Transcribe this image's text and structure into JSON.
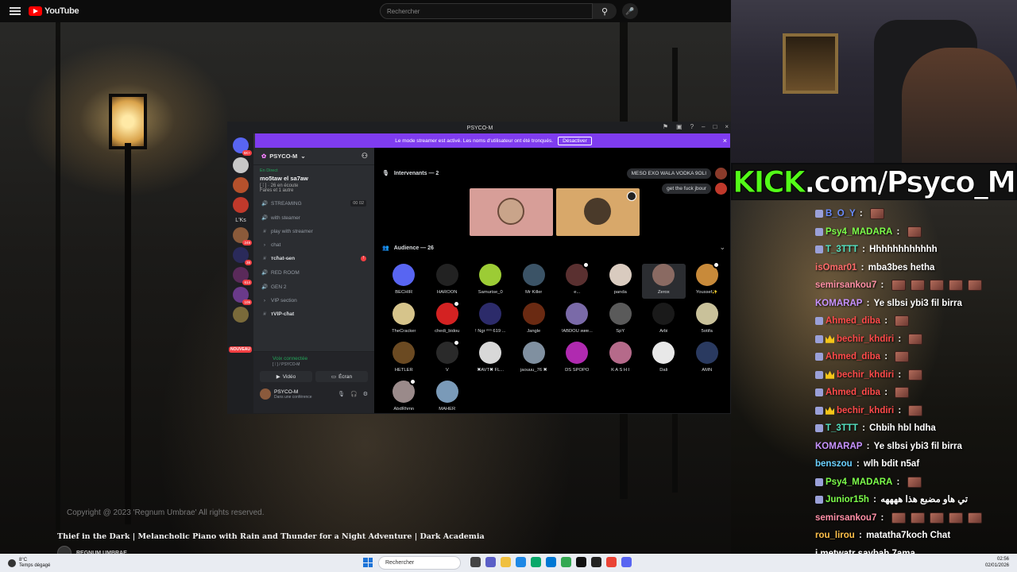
{
  "youtube": {
    "logo_text": "YouTube",
    "search_placeholder": "Rechercher",
    "copyright": "Copyright @ 2023 'Regnum Umbrae' All rights reserved.",
    "video_title": "Thief in the Dark | Melancholic Piano with Rain and Thunder for a Night Adventure | Dark Academia",
    "channel_name": "REGNUM UMBRAE"
  },
  "discord": {
    "window_title": "PSYCO-M",
    "banner_text": "Le mode streamer est activé. Les noms d'utilisateur ont été tronqués.",
    "banner_button": "Désactiver",
    "server_name": "PSYCO-M",
    "server_list": {
      "badge_1": "5K+",
      "text_item": "L'Ks",
      "badge_2": "249",
      "badge_3": "38",
      "badge_4": "614",
      "badge_5": "109",
      "new_label": "NOUVEAU"
    },
    "live": {
      "status": "En Direct",
      "title": "mo5taw el sa7aw",
      "sub": "[ ⁞ ]  ·  26 en écoute",
      "hosts": "Fares et 1 autre"
    },
    "channels": [
      {
        "label": "STREAMING",
        "count": "00 02"
      },
      {
        "label": "with steamer"
      },
      {
        "label": "play with streamer"
      },
      {
        "label": "chat"
      },
      {
        "label": "ᴛcħat-ɢen"
      },
      {
        "label": "RED ROOM"
      },
      {
        "label": "GEN 2"
      },
      {
        "label": "VIP section"
      },
      {
        "label": "ᴛVIP-cħat"
      }
    ],
    "voice": {
      "connected": "Voix connectée",
      "channel": "[ ⁞ ] / PSYCO-M",
      "video_btn": "Vidéo",
      "screen_btn": "Écran"
    },
    "user": {
      "name": "PSYCO-M",
      "status": "Dans une conférence"
    },
    "stage": {
      "speakers_header": "Intervenants — 2",
      "audience_header": "Audience — 26",
      "chat_chips": [
        "MESO EXO WALA VODKA 9OLI",
        "get the fuck jbour"
      ],
      "audience": [
        {
          "name": "BECHIR",
          "color": "#5865f2"
        },
        {
          "name": "HAROON",
          "color": "#222222"
        },
        {
          "name": "Samurise_0",
          "color": "#9ccc35"
        },
        {
          "name": "Mr Killer",
          "color": "#3b5366"
        },
        {
          "name": "e...",
          "color": "#5a3030"
        },
        {
          "name": "panda",
          "color": "#d9cbbf"
        },
        {
          "name": "Zerox",
          "color": "#8a6a62"
        },
        {
          "name": "Youssef✨",
          "color": "#c88a3a"
        },
        {
          "name": "TheCracker",
          "color": "#d6c48b"
        },
        {
          "name": "chedi_bidou",
          "color": "#d42222"
        },
        {
          "name": "! Ngr ᵐᵐ 619 ...",
          "color": "#2c2b6a"
        },
        {
          "name": "Jangle",
          "color": "#6a2a12"
        },
        {
          "name": "!ABDOU ʍʀɐ...",
          "color": "#7a6aa8"
        },
        {
          "name": "SpY",
          "color": "#5a5a5a"
        },
        {
          "name": "Arbi",
          "color": "#1a1a1a"
        },
        {
          "name": "5otifa",
          "color": "#c9c19a"
        },
        {
          "name": "HETLER",
          "color": "#6b4a22"
        },
        {
          "name": "V",
          "color": "#2a2a2a"
        },
        {
          "name": "✖AVT✖ FL...",
          "color": "#d8d8d8"
        },
        {
          "name": "jaouuu_76 ✖",
          "color": "#8090a0"
        },
        {
          "name": "DS SPOPO",
          "color": "#b02ab0"
        },
        {
          "name": "K A S H I",
          "color": "#b56a8a"
        },
        {
          "name": "Dali",
          "color": "#e8e8e8"
        },
        {
          "name": "AMN",
          "color": "#2a3a60"
        },
        {
          "name": "AbdRhmn",
          "color": "#9a8a8a"
        },
        {
          "name": "MAHER",
          "color": "#7a9ab8"
        }
      ]
    }
  },
  "stream": {
    "kick_brand": "KICK",
    "kick_rest": ".com/Psyco_M",
    "chat": [
      {
        "user": "B_O_Y",
        "color": "#6a8cff",
        "text": "",
        "badges": [
          "badge"
        ],
        "emotes": 1
      },
      {
        "user": "Psy4_MADARA",
        "color": "#7cfc4a",
        "text": "",
        "badges": [
          "badge"
        ],
        "emotes": 1
      },
      {
        "user": "T_3TTT",
        "color": "#53e0c0",
        "text": "Hhhhhhhhhhhh",
        "badges": [
          "badge"
        ],
        "emotes": 0
      },
      {
        "user": "isOmar01",
        "color": "#ff6a6a",
        "text": "mba3bes hetha",
        "badges": [],
        "emotes": 0
      },
      {
        "user": "semirsankou7",
        "color": "#ff8fa6",
        "text": "",
        "badges": [],
        "emotes": 5
      },
      {
        "user": "KOMARAP",
        "color": "#c792ff",
        "text": "Ye slbsi ybi3 fil birra",
        "badges": [],
        "emotes": 0
      },
      {
        "user": "Ahmed_diba",
        "color": "#ff4a4a",
        "text": "",
        "badges": [
          "badge"
        ],
        "emotes": 1
      },
      {
        "user": "bechir_khdiri",
        "color": "#ff4a4a",
        "text": "",
        "badges": [
          "badge",
          "crown"
        ],
        "emotes": 1
      },
      {
        "user": "Ahmed_diba",
        "color": "#ff4a4a",
        "text": "",
        "badges": [
          "badge"
        ],
        "emotes": 1
      },
      {
        "user": "bechir_khdiri",
        "color": "#ff4a4a",
        "text": "",
        "badges": [
          "badge",
          "crown"
        ],
        "emotes": 1
      },
      {
        "user": "Ahmed_diba",
        "color": "#ff4a4a",
        "text": "",
        "badges": [
          "badge"
        ],
        "emotes": 1
      },
      {
        "user": "bechir_khdiri",
        "color": "#ff4a4a",
        "text": "",
        "badges": [
          "badge",
          "crown"
        ],
        "emotes": 1
      },
      {
        "user": "T_3TTT",
        "color": "#53e0c0",
        "text": "Chbih hbl hdha",
        "badges": [
          "badge"
        ],
        "emotes": 0
      },
      {
        "user": "KOMARAP",
        "color": "#c792ff",
        "text": "Ye slbsi ybi3 fil birra",
        "badges": [],
        "emotes": 0
      },
      {
        "user": "benszou",
        "color": "#6ad0ff",
        "text": "wlh bdit n5af",
        "badges": [],
        "emotes": 0
      },
      {
        "user": "Psy4_MADARA",
        "color": "#7cfc4a",
        "text": "",
        "badges": [
          "badge"
        ],
        "emotes": 1
      },
      {
        "user": "Junior15h",
        "color": "#7cfc4a",
        "text": "تي هاو مضبع هذا ههههه",
        "badges": [
          "badge"
        ],
        "emotes": 0
      },
      {
        "user": "semirsankou7",
        "color": "#ff8fa6",
        "text": "",
        "badges": [],
        "emotes": 5
      },
      {
        "user": "rou_lirou",
        "color": "#ffc04a",
        "text": "matatha7koch Chat",
        "badges": [],
        "emotes": 0
      },
      {
        "user": "",
        "color": "#ffffff",
        "text": "i metwatr saybah 7ama",
        "badges": [],
        "emotes": 0
      }
    ]
  },
  "taskbar": {
    "weather_temp": "8°C",
    "weather_desc": "Temps dégagé",
    "search": "Rechercher",
    "time": "02:56",
    "date": "02/01/2026"
  }
}
